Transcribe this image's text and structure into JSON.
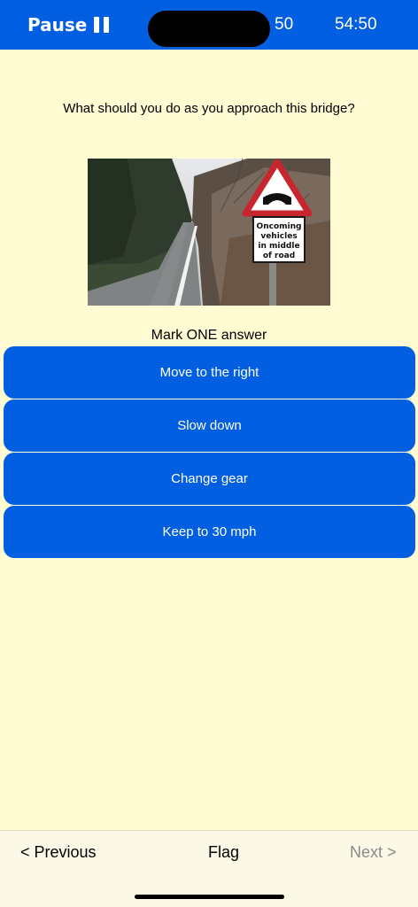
{
  "header": {
    "pause_label": "Pause",
    "question_number": "50",
    "timer": "54:50"
  },
  "question": {
    "text": "What should you do as you approach this bridge?",
    "sign_text": "Oncoming vehicles in middle of road",
    "sign_lines": [
      "Oncoming",
      "vehicles",
      "in middle",
      "of road"
    ]
  },
  "instructions": "Mark ONE answer",
  "answers": [
    {
      "label": "Move to the right"
    },
    {
      "label": "Slow down"
    },
    {
      "label": "Change gear"
    },
    {
      "label": "Keep to 30 mph"
    }
  ],
  "footer": {
    "previous_label": "< Previous",
    "flag_label": "Flag",
    "next_label": "Next >"
  },
  "colors": {
    "accent": "#035fe1",
    "background": "#fffbd2",
    "footer_background": "#fbf8e5",
    "disabled_text": "#8a8a8a"
  }
}
